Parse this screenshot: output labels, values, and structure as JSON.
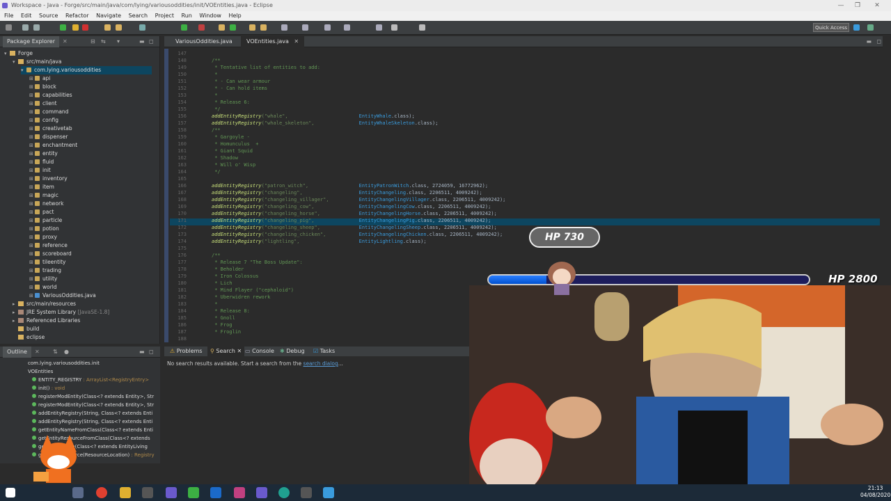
{
  "window": {
    "title": "Workspace - Java - Forge/src/main/java/com/lying/variousoddities/init/VOEntities.java - Eclipse"
  },
  "menu": [
    "File",
    "Edit",
    "Source",
    "Refactor",
    "Navigate",
    "Search",
    "Project",
    "Run",
    "Window",
    "Help"
  ],
  "toolbar": {
    "quick_access": "Quick Access"
  },
  "package_explorer": {
    "tab": "Package Explorer",
    "project": "Forge",
    "src": "src/main/java",
    "package": "com.lying.variousoddities",
    "subpackages": [
      "api",
      "block",
      "capabilities",
      "client",
      "command",
      "config",
      "creativetab",
      "dispenser",
      "enchantment",
      "entity",
      "fluid",
      "init",
      "inventory",
      "item",
      "magic",
      "network",
      "pact",
      "particle",
      "potion",
      "proxy",
      "reference",
      "scoreboard",
      "tileentity",
      "trading",
      "utility",
      "world"
    ],
    "main_file": "VariousOddities.java",
    "resources": "src/main/resources",
    "jre": "JRE System Library",
    "jre_version": "[JavaSE-1.8]",
    "ref_libs": "Referenced Libraries",
    "build": "build",
    "eclipse": "eclipse"
  },
  "editor": {
    "tabs": [
      "VariousOddities.java",
      "VOEntities.java"
    ],
    "lines": [
      {
        "n": "147",
        "t": ""
      },
      {
        "n": "148",
        "t": "/**",
        "c": "cmt"
      },
      {
        "n": "149",
        "t": " * Tentative list of entities to add:",
        "c": "cmt"
      },
      {
        "n": "150",
        "t": " *",
        "c": "cmt"
      },
      {
        "n": "151",
        "t": " * - Can wear armour",
        "c": "cmt"
      },
      {
        "n": "152",
        "t": " * - Can hold items",
        "c": "cmt"
      },
      {
        "n": "153",
        "t": " *",
        "c": "cmt"
      },
      {
        "n": "154",
        "t": " * Release 6:",
        "c": "cmt"
      },
      {
        "n": "155",
        "t": " */",
        "c": "cmt"
      },
      {
        "n": "156",
        "f": "addEntityRegistry",
        "s": "(\"whale\",",
        "k": "EntityWhale",
        "e": ".class);"
      },
      {
        "n": "157",
        "f": "addEntityRegistry",
        "s": "(\"whale_skeleton\",",
        "k": "EntityWhaleSkeleton",
        "e": ".class);"
      },
      {
        "n": "158",
        "t": "/**",
        "c": "cmt"
      },
      {
        "n": "159",
        "t": " * Gargoyle -",
        "c": "cmt"
      },
      {
        "n": "160",
        "t": " * Homunculus  +",
        "c": "cmt"
      },
      {
        "n": "161",
        "t": " * Giant Squid",
        "c": "cmt"
      },
      {
        "n": "162",
        "t": " * Shadow",
        "c": "cmt"
      },
      {
        "n": "163",
        "t": " * Will o' Wisp",
        "c": "cmt"
      },
      {
        "n": "164",
        "t": " */",
        "c": "cmt"
      },
      {
        "n": "165",
        "t": ""
      },
      {
        "n": "166",
        "f": "addEntityRegistry",
        "s": "(\"patron_witch\",",
        "k": "EntityPatronWitch",
        "e": ".class, 2724059, 16772962);"
      },
      {
        "n": "167",
        "f": "addEntityRegistry",
        "s": "(\"changeling\",",
        "k": "EntityChangeling",
        "e": ".class, 2206511, 4009242);"
      },
      {
        "n": "168",
        "f": "addEntityRegistry",
        "s": "(\"changeling_villager\",",
        "k": "EntityChangelingVillager",
        "e": ".class, 2206511, 4009242);"
      },
      {
        "n": "169",
        "f": "addEntityRegistry",
        "s": "(\"changeling_cow\",",
        "k": "EntityChangelingCow",
        "e": ".class, 2206511, 4009242);"
      },
      {
        "n": "170",
        "f": "addEntityRegistry",
        "s": "(\"changeling_horse\",",
        "k": "EntityChangelingHorse",
        "e": ".class, 2206511, 4009242);"
      },
      {
        "n": "171",
        "f": "addEntityRegistry",
        "s": "(\"changeling_pig\",",
        "k": "EntityChangelingPig",
        "e": ".class, 2206511, 4009242);"
      },
      {
        "n": "172",
        "f": "addEntityRegistry",
        "s": "(\"changeling_sheep\",",
        "k": "EntityChangelingSheep",
        "e": ".class, 2206511, 4009242);"
      },
      {
        "n": "173",
        "f": "addEntityRegistry",
        "s": "(\"changeling_chicken\",",
        "k": "EntityChangelingChicken",
        "e": ".class, 2206511, 4009242);"
      },
      {
        "n": "174",
        "f": "addEntityRegistry",
        "s": "(\"lightling\",",
        "k": "EntityLightling",
        "e": ".class);"
      },
      {
        "n": "175",
        "t": ""
      },
      {
        "n": "176",
        "t": "/**",
        "c": "cmt"
      },
      {
        "n": "177",
        "t": " * Release 7 \"The Boss Update\":",
        "c": "cmt"
      },
      {
        "n": "178",
        "t": " * Beholder",
        "c": "cmt"
      },
      {
        "n": "179",
        "t": " * Iron Colossus",
        "c": "cmt"
      },
      {
        "n": "180",
        "t": " * Lich",
        "c": "cmt"
      },
      {
        "n": "181",
        "t": " * Mind Flayer (\"cephaloid\")",
        "c": "cmt"
      },
      {
        "n": "182",
        "t": " * Uberwidren rework",
        "c": "cmt"
      },
      {
        "n": "183",
        "t": " *",
        "c": "cmt"
      },
      {
        "n": "184",
        "t": " * Release 8:",
        "c": "cmt"
      },
      {
        "n": "185",
        "t": " * Gnoll",
        "c": "cmt"
      },
      {
        "n": "186",
        "t": " * Frog",
        "c": "cmt"
      },
      {
        "n": "187",
        "t": " * Froglin",
        "c": "cmt"
      },
      {
        "n": "188",
        "t": ""
      }
    ]
  },
  "outline": {
    "tab": "Outline",
    "pkg": "com.lying.variousoddities.init",
    "cls": "VOEntities",
    "items": [
      {
        "name": "ENTITY_REGISTRY",
        "type": " : ArrayList<RegistryEntry>"
      },
      {
        "name": "init()",
        "type": " : void"
      },
      {
        "name": "registerModEntity(Class<? extends Entity>, Str",
        "type": ""
      },
      {
        "name": "registerModEntity(Class<? extends Entity>, Str",
        "type": ""
      },
      {
        "name": "addEntityRegistry(String, Class<? extends Enti",
        "type": ""
      },
      {
        "name": "addEntityRegistry(String, Class<? extends Enti",
        "type": ""
      },
      {
        "name": "getEntityNameFromClass(Class<? extends Enti",
        "type": ""
      },
      {
        "name": "getEntityResourceFromClass(Class<? extends",
        "type": ""
      },
      {
        "name": "getEntityName(Class<? extends EntityLiving",
        "type": ""
      },
      {
        "name": "getEntityResource(ResourceLocation)",
        "type": " : Registry"
      }
    ]
  },
  "console": {
    "tabs": [
      "Problems",
      "Search",
      "Console",
      "Debug",
      "Tasks"
    ],
    "message": "No search results available. Start a search from the ",
    "link": "search dialog",
    "suffix": "..."
  },
  "overlay": {
    "hp_bubble": "HP 730",
    "hp_big": "HP 2800",
    "hp_fraction": 0.18
  },
  "taskbar": {
    "time": "21:13",
    "date": "04/08/2020"
  },
  "colors": {
    "editor_bg": "#2b2b2b",
    "accent": "#0d4660",
    "hp_blue": "#2a7fff"
  }
}
